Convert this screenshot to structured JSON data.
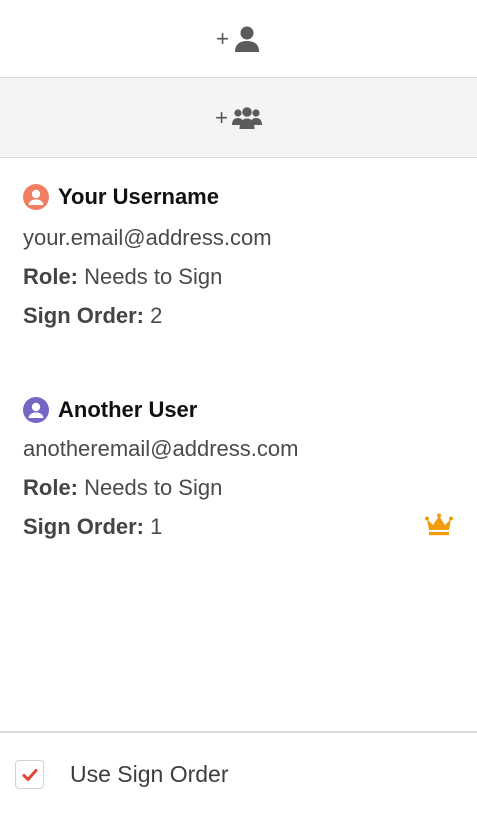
{
  "actions": {
    "add_user_plus": "+",
    "add_group_plus": "+"
  },
  "signers": [
    {
      "name": "Your Username",
      "email": "your.email@address.com",
      "role_label": "Role:",
      "role_value": "Needs to Sign",
      "order_label": "Sign Order:",
      "order_value": "2",
      "avatar_color": "#f07e62",
      "is_owner": false
    },
    {
      "name": "Another User",
      "email": "anotheremail@address.com",
      "role_label": "Role:",
      "role_value": "Needs to Sign",
      "order_label": "Sign Order:",
      "order_value": "1",
      "avatar_color": "#7466c4",
      "is_owner": true
    }
  ],
  "footer": {
    "checkbox_checked": true,
    "checkbox_label": "Use Sign Order"
  },
  "colors": {
    "crown": "#f39c0b",
    "check": "#e2452f"
  }
}
